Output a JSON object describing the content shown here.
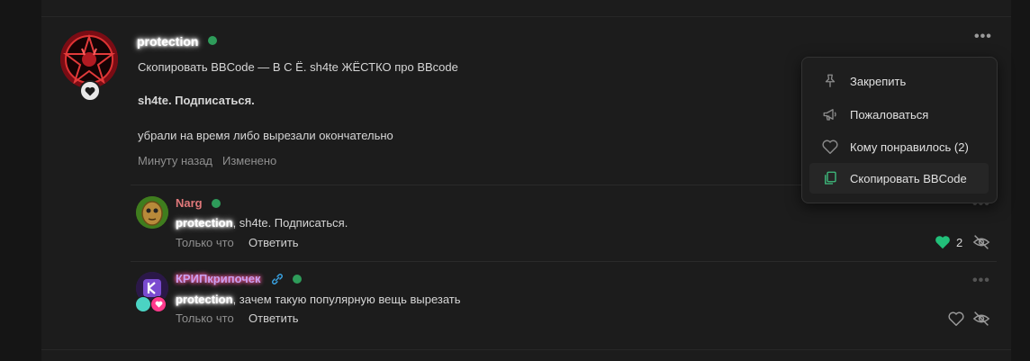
{
  "post": {
    "author": "protection",
    "text_line1": "Скопировать BBCode — В С Ё. sh4te ЖЁСТКО про BBcode",
    "text_line2": "sh4te. Подписаться.",
    "text_line3": "убрали на время либо вырезали окончательно",
    "time": "Минуту назад",
    "edited": "Изменено",
    "more_dots": "•••"
  },
  "menu": {
    "items": [
      {
        "label": "Закрепить",
        "icon": "pin-icon"
      },
      {
        "label": "Пожаловаться",
        "icon": "megaphone-icon"
      },
      {
        "label": "Кому понравилось (2)",
        "icon": "heart-outline-icon"
      },
      {
        "label": "Скопировать BBCode",
        "icon": "copy-icon"
      }
    ]
  },
  "replies": [
    {
      "author": "Narg",
      "author_color": "#e0787a",
      "mention": "protection",
      "text": ", sh4te. Подписаться.",
      "time": "Только что",
      "reply_label": "Ответить",
      "likes": "2",
      "more_dots": "•••"
    },
    {
      "author": "КРИПкрипочек",
      "author_color": "#c9a0f0",
      "mention": "protection",
      "text": ", зачем такую популярную вещь вырезать",
      "time": "Только что",
      "reply_label": "Ответить",
      "more_dots": "•••"
    }
  ],
  "colors": {
    "online": "#2e9c5a",
    "like_active": "#22c07a",
    "copy_icon": "#3fbf7f"
  }
}
